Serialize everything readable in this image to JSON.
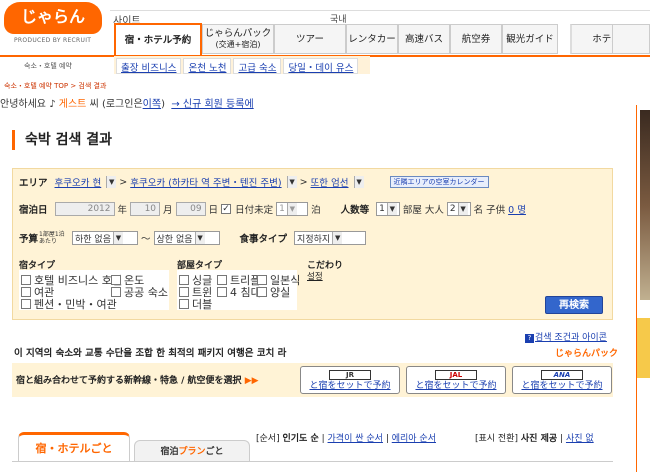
{
  "header": {
    "logo_text": "じゃらん",
    "logo_sub": "PRODUCED BY RECRUIT",
    "site_label": "사이트",
    "domestic_label": "국내",
    "tabs": [
      {
        "label": "宿・ホテル予約",
        "active": true
      },
      {
        "label": "じゃらんパック",
        "sub": "(交通+宿泊)"
      },
      {
        "label": "ツアー"
      },
      {
        "label": "レンタカー"
      },
      {
        "label": "高速バス"
      },
      {
        "label": "航空券"
      },
      {
        "label": "観光ガイド"
      },
      {
        "label": "ホテル"
      }
    ]
  },
  "subnav": {
    "left_label": "숙소・호텔 예약",
    "links": [
      "출장 비즈니스",
      "온천 노천",
      "고급 숙소",
      "당일・데이 유스"
    ]
  },
  "breadcrumb": "숙소・호텔 예약 TOP > 검색 결과",
  "greeting": {
    "hello": "안녕하세요",
    "guest": "게스트",
    "suffix": "씨",
    "login_prefix": "(로그인은",
    "login_link": "이쪽",
    "login_suffix": ")",
    "register_link": "→ 신규 회원 등록에"
  },
  "page_title": "숙박 검색 결과",
  "search": {
    "area_label": "エリア",
    "area_pref": "후쿠오카 현",
    "area_city": "후쿠오카 (하카타 역 주변・텐진 주변)",
    "area_sub": "또한 엄선",
    "calendar_btn": "近隣エリアの空室カレンダー",
    "date_label": "宿泊日",
    "year": "2012",
    "year_unit": "年",
    "month": "10",
    "month_unit": "月",
    "day": "09",
    "day_unit": "日",
    "undecided": "日付未定",
    "nights": "1",
    "nights_unit": "泊",
    "rooms_label": "人数等",
    "rooms": "1",
    "rooms_unit": "部屋",
    "adults_label": "大人",
    "adults": "2",
    "adults_unit": "名",
    "child_label": "子供",
    "child_value": "0 명",
    "budget_label": "予算",
    "budget_sub": "1部屋1泊あたり",
    "budget_min": "하한 없음",
    "budget_tilde": "〜",
    "budget_max": "상한 없음",
    "meal_label": "食事タイプ",
    "meal": "지정하지",
    "hotel_type_label": "宿タイプ",
    "hotel_types": [
      "호텔 비즈니스 호텔",
      "온도",
      "여관",
      "공공 숙소",
      "펜션・민박・여관"
    ],
    "room_type_label": "部屋タイプ",
    "room_types": [
      "싱글",
      "트리플",
      "일본식",
      "트윈",
      "4 침대",
      "양실",
      "더블"
    ],
    "kodawari_label": "こだわり",
    "kodawari_link": "설정",
    "search_btn": "再検索"
  },
  "help_link": "검색 조건과 아이콘",
  "package_text": "이 지역의 숙소와 교통 수단을 조합 한 최적의 패키지 여행은 코치 라",
  "jalan_pack": "じゃらんパック",
  "flight": {
    "text": "宿と組み合わせて予約する新幹線・特急 / 航空便を選択",
    "arrows": "▶▶",
    "carriers": [
      {
        "name": "JR",
        "cta": "と宿をセットで予約"
      },
      {
        "name": "JAL",
        "cta": "と宿をセットで予約"
      },
      {
        "name": "ANA",
        "cta": "と宿をセットで予約"
      }
    ]
  },
  "results_tabs": {
    "tab1": "宿・ホテルごと",
    "tab2_a": "宿泊",
    "tab2_b": "プラン",
    "tab2_c": "ごと"
  },
  "sort": {
    "prefix": "[순서]",
    "popular": "인기도 순",
    "sep": "|",
    "cheap": "가격이 싼 순서",
    "review": "에리아 순서"
  },
  "photo": {
    "prefix": "[표시 전환]",
    "label": "사진 제공",
    "sep": "|",
    "link": "사진 없"
  }
}
